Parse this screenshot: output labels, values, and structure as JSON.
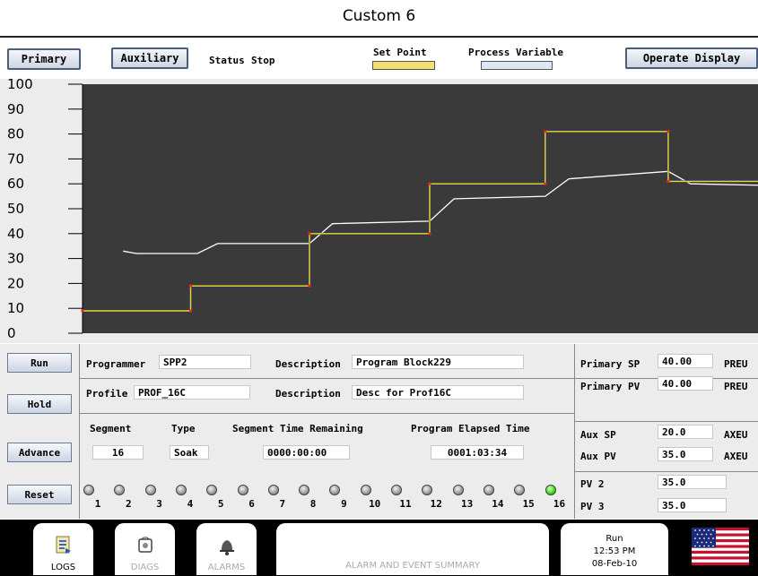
{
  "window": {
    "title": "Custom 6"
  },
  "toolbar": {
    "primary_label": "Primary",
    "auxiliary_label": "Auxiliary",
    "status_label": "Status",
    "status_value": "Stop",
    "legend_sp": "Set Point",
    "legend_pv": "Process Variable",
    "operate_label": "Operate Display",
    "sp_color": "#f0e070",
    "pv_color": "#dce6f4"
  },
  "chart_data": {
    "type": "line",
    "ylim": [
      0,
      100
    ],
    "yticks": [
      0,
      10,
      20,
      30,
      40,
      50,
      60,
      70,
      80,
      90,
      100
    ],
    "background": "#3a3a3a",
    "series": [
      {
        "name": "Set Point",
        "color": "#f0e000",
        "x": [
          0,
          0.16,
          0.16,
          0.336,
          0.336,
          0.514,
          0.514,
          0.685,
          0.685,
          0.867,
          0.867,
          1.08,
          1.08,
          1.29,
          1.29,
          1.5
        ],
        "y": [
          9,
          9,
          19,
          19,
          40,
          40,
          60,
          60,
          81,
          81,
          61,
          61,
          40,
          40,
          19,
          19
        ]
      },
      {
        "name": "Process Variable",
        "color": "#ffffff",
        "x": [
          0.06,
          0.08,
          0.17,
          0.2,
          0.336,
          0.37,
          0.514,
          0.55,
          0.685,
          0.72,
          0.867,
          0.9,
          1.08,
          1.12,
          1.29,
          1.33,
          1.5
        ],
        "y": [
          33,
          32,
          32,
          36,
          36,
          44,
          45,
          54,
          55,
          62,
          65,
          60,
          59,
          50,
          44,
          38,
          35
        ]
      }
    ]
  },
  "side_buttons": {
    "run": "Run",
    "hold": "Hold",
    "advance": "Advance",
    "reset": "Reset"
  },
  "program": {
    "programmer_label": "Programmer",
    "programmer_value": "SPP2",
    "desc1_label": "Description",
    "desc1_value": "Program Block229",
    "profile_label": "Profile",
    "profile_value": "PROF_16C",
    "desc2_label": "Description",
    "desc2_value": "Desc for Prof16C",
    "segment_label": "Segment",
    "segment_value": "16",
    "type_label": "Type",
    "type_value": "Soak",
    "seg_time_label": "Segment Time Remaining",
    "seg_time_value": "0000:00:00",
    "elapsed_label": "Program Elapsed Time",
    "elapsed_value": "0001:03:34"
  },
  "events": {
    "labels": [
      "1",
      "2",
      "3",
      "4",
      "5",
      "6",
      "7",
      "8",
      "9",
      "10",
      "11",
      "12",
      "13",
      "14",
      "15",
      "16"
    ],
    "active_index": 15
  },
  "process": {
    "primary_sp_label": "Primary SP",
    "primary_sp_value": "40.00",
    "primary_sp_unit": "PREU",
    "primary_pv_label": "Primary PV",
    "primary_pv_value": "40.00",
    "primary_pv_unit": "PREU",
    "aux_sp_label": "Aux SP",
    "aux_sp_value": "20.0",
    "aux_sp_unit": "AXEU",
    "aux_pv_label": "Aux PV",
    "aux_pv_value": "35.0",
    "aux_pv_unit": "AXEU",
    "pv2_label": "PV 2",
    "pv2_value": "35.0",
    "pv3_label": "PV 3",
    "pv3_value": "35.0"
  },
  "footer": {
    "logs": "LOGS",
    "diags": "DIAGS",
    "alarms": "ALARMS",
    "summary": "ALARM AND EVENT SUMMARY",
    "run_state": "Run",
    "time": "12:53 PM",
    "date": "08-Feb-10"
  }
}
